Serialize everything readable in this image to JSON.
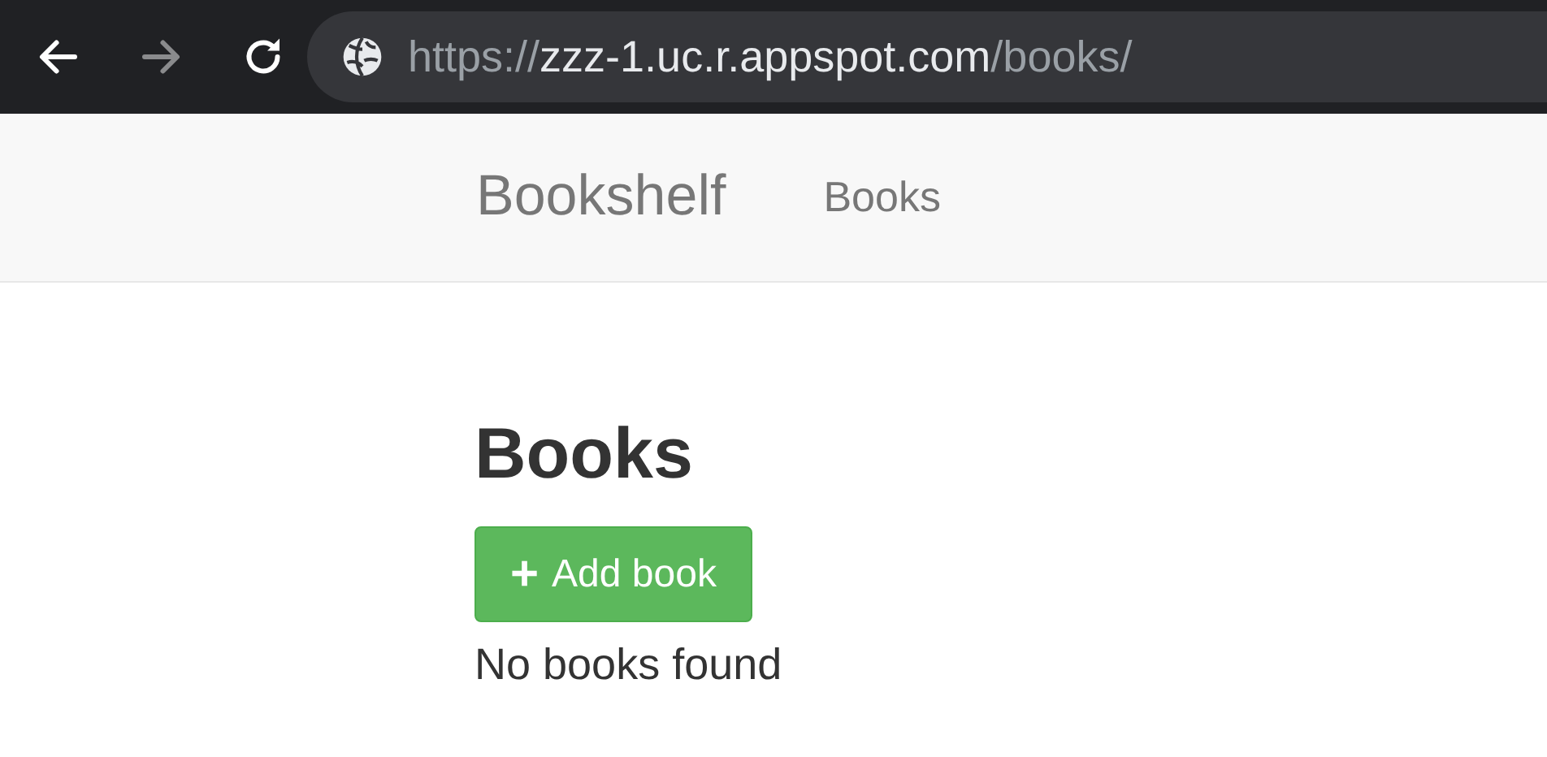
{
  "browser": {
    "buttons": [
      {
        "kind": "back",
        "disabled": false
      },
      {
        "kind": "forward",
        "disabled": true
      },
      {
        "kind": "reload",
        "disabled": false
      }
    ],
    "url": [
      {
        "text": "https://",
        "kind": "muted"
      },
      {
        "text": "zzz-1.uc.r.appspot.com",
        "kind": "host"
      },
      {
        "text": "/books/",
        "kind": "muted"
      }
    ]
  },
  "navbar": {
    "brand": "Bookshelf",
    "links": [
      "Books"
    ]
  },
  "content": {
    "title": "Books",
    "add_button": {
      "icon": "+",
      "label": "Add book"
    },
    "empty_message": "No books found"
  }
}
